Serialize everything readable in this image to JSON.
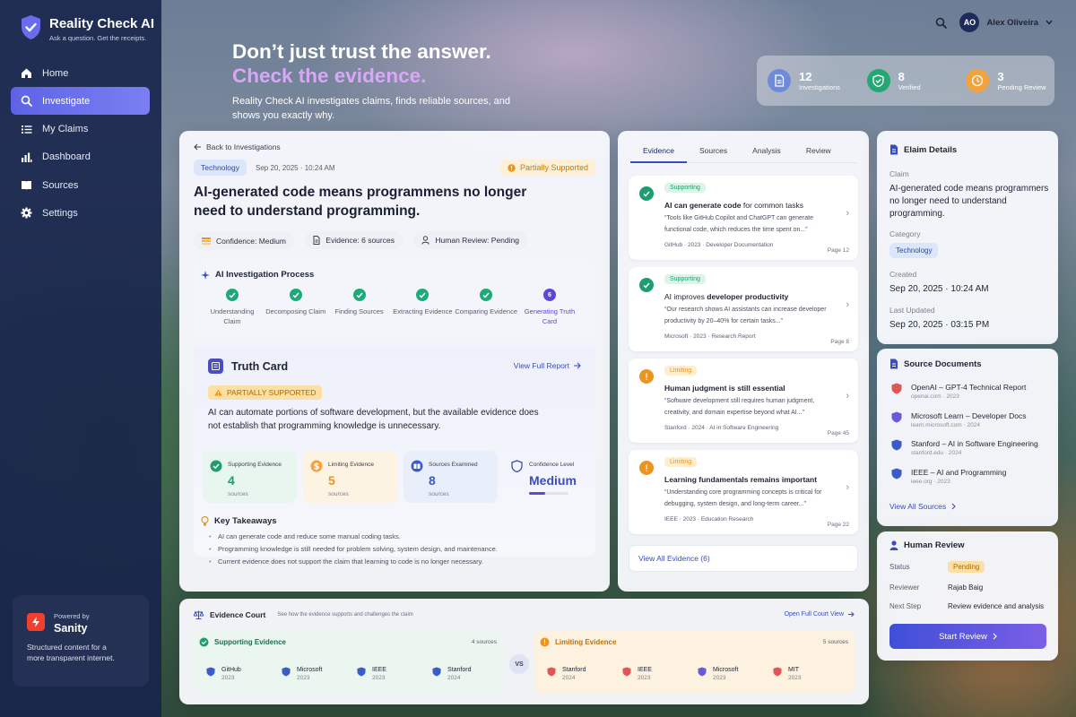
{
  "app": {
    "name": "Reality Check AI",
    "tagline": "Ask a question. Get the receipts."
  },
  "nav": [
    {
      "label": "Home",
      "icon": "home-icon",
      "active": false
    },
    {
      "label": "Investigate",
      "icon": "search-icon",
      "active": true
    },
    {
      "label": "My Claims",
      "icon": "list-icon",
      "active": false
    },
    {
      "label": "Dashboard",
      "icon": "bar-chart-icon",
      "active": false
    },
    {
      "label": "Sources",
      "icon": "book-icon",
      "active": false
    },
    {
      "label": "Settings",
      "icon": "gear-icon",
      "active": false
    }
  ],
  "sanity": {
    "powered": "Powered by",
    "name": "Sanity",
    "desc": "Structured content for a more transparent internet."
  },
  "user": {
    "initials": "AO",
    "name": "Alex Oliveira"
  },
  "hero": {
    "line1": "Don’t just trust the answer.",
    "line2": "Check the evidence.",
    "sub": "Reality Check AI investigates claims, finds reliable sources, and shows you exactly why."
  },
  "stats": [
    {
      "value": "12",
      "label": "Investigations",
      "color": "#6f8ad8"
    },
    {
      "value": "8",
      "label": "Verified",
      "color": "#23a874"
    },
    {
      "value": "3",
      "label": "Pending Review",
      "color": "#f2a33c"
    }
  ],
  "claim": {
    "back": "Back to Investigations",
    "category": "Technology",
    "date": "Sep 20, 2025 · 10:24 AM",
    "status": "Partially Supported",
    "title": "AI-generated code means programmens no longer need to understand programming.",
    "confidence": "Confidence: Medium",
    "evidence": "Evidence: 6 sources",
    "review": "Human Review: Pending"
  },
  "process": {
    "title": "AI Investigation Process",
    "steps": [
      {
        "label": "Understanding Claim",
        "done": true
      },
      {
        "label": "Decomposing Claim",
        "done": true
      },
      {
        "label": "Finding Sources",
        "done": true
      },
      {
        "label": "Extracting Evidence",
        "done": true
      },
      {
        "label": "Comparing Evidence",
        "done": true
      },
      {
        "label": "Generating Truth Card",
        "done": false,
        "num": "6"
      }
    ]
  },
  "truth": {
    "title": "Truth Card",
    "link": "View Full Report",
    "verdict": "PARTIALLY SUPPORTED",
    "summary": "AI can automate portions of software development, but the available evidence does not establish that programming knowledge is unnecessary.",
    "metrics": [
      {
        "label": "Supporting Evidence",
        "value": "4",
        "sub": "sources",
        "color": "#1e9e6e",
        "bg": "#e8f6ef"
      },
      {
        "label": "Limiting Evidence",
        "value": "5",
        "sub": "sources",
        "color": "#e9951f",
        "bg": "#fdf3e3"
      },
      {
        "label": "Sources Examined",
        "value": "8",
        "sub": "sources",
        "color": "#3b5bc8",
        "bg": "#e9eefb"
      },
      {
        "label": "Confidence Level",
        "value": "Medium",
        "sub": "",
        "color": "#3b4db8",
        "bg": "transparent",
        "level": 0.4
      }
    ],
    "takeaways_title": "Key Takeaways",
    "takeaways": [
      "AI can generate code and reduce some manual coding tasks.",
      "Programming knowledge is still needed for problem solving, system design, and maintenance.",
      "Current evidence does not support the claim that learning to code is no longer necessary."
    ]
  },
  "evidence_tabs": [
    "Evidence",
    "Sources",
    "Analysis",
    "Review"
  ],
  "evidence": [
    {
      "tag": "Supporting",
      "type": "support",
      "title_pre": "AI can generate code",
      "title_post": " for common tasks",
      "quote": "“Tools like GitHub Copilot and ChatGPT can generate functional code, which reduces the time spent on...”",
      "src": "GitHub  ·  2023  ·  Developer Documentation",
      "page": "Page 12"
    },
    {
      "tag": "Supporting",
      "type": "support",
      "title_pre": "AI improves ",
      "title_post": "developer productivity",
      "quote": "“Our research shows AI assistants can increase developer productivity by 20–40% for certain tasks...”",
      "src": "Microsoft  ·  2023  ·  Research Report",
      "page": "Page 8"
    },
    {
      "tag": "Limiting",
      "type": "limit",
      "title_pre": "Human judgment is still essential",
      "title_post": "",
      "quote": "“Software development still requires human judgment, creativity, and domain expertise beyond what AI...”",
      "src": "Stanford  ·  2024  ·  AI in Software Engineering",
      "page": "Page 45"
    },
    {
      "tag": "Limiting",
      "type": "limit",
      "title_pre": "Learning fundamentals remains important",
      "title_post": "",
      "quote": "“Understanding core programming concepts is critical for debugging, system design, and long-term career...”",
      "src": "IEEE  ·  2023  ·  Education Research",
      "page": "Page 22"
    }
  ],
  "view_all_evidence": "View All Evidence (6)",
  "details": {
    "title": "Elaim Details",
    "claim_lbl": "Claim",
    "claim": "AI-generated code means programmers no longer need to understand programming.",
    "cat_lbl": "Category",
    "cat": "Technology",
    "created_lbl": "Created",
    "created": "Sep 20, 2025 · 10:24 AM",
    "updated_lbl": "Last Updated",
    "updated": "Sep 20, 2025 · 03:15 PM"
  },
  "source_docs": {
    "title": "Source Documents",
    "items": [
      {
        "title": "OpenAI – GPT-4 Technical Report",
        "sub": "openai.com  ·  2023",
        "color": "#e05555"
      },
      {
        "title": "Microsoft Learn – Developer Docs",
        "sub": "learn.microsoft.com  ·  2024",
        "color": "#6a5cd8"
      },
      {
        "title": "Stanford – AI in Software Engineering",
        "sub": "stanford.edu  ·  2024",
        "color": "#3b5bc8"
      },
      {
        "title": "IEEE – AI and Programming",
        "sub": "ieee.org  ·  2023",
        "color": "#3b5bc8"
      }
    ],
    "link": "View All Sources"
  },
  "human": {
    "title": "Human Review",
    "status_lbl": "Status",
    "status": "Pending",
    "reviewer_lbl": "Reviewer",
    "reviewer": "Rajab Baig",
    "next_lbl": "Next Step",
    "next": "Review evidence and analysis",
    "button": "Start Review"
  },
  "court": {
    "title": "Evidence Court",
    "sub": "See how the evidence supports and challenges the claim",
    "link": "Open Full Court View",
    "vs": "VS",
    "supporting": {
      "title": "Supporting Evidence",
      "count": "4 sources",
      "items": [
        {
          "name": "GitHub",
          "year": "2023"
        },
        {
          "name": "Microsoft",
          "year": "2023"
        },
        {
          "name": "IEEE",
          "year": "2023"
        },
        {
          "name": "Stanford",
          "year": "2024"
        }
      ]
    },
    "limiting": {
      "title": "Limiting Evidence",
      "count": "5 sources",
      "items": [
        {
          "name": "Stanford",
          "year": "2024"
        },
        {
          "name": "IEEE",
          "year": "2023"
        },
        {
          "name": "Microsoft",
          "year": "2023"
        },
        {
          "name": "MIT",
          "year": "2023"
        }
      ]
    }
  }
}
